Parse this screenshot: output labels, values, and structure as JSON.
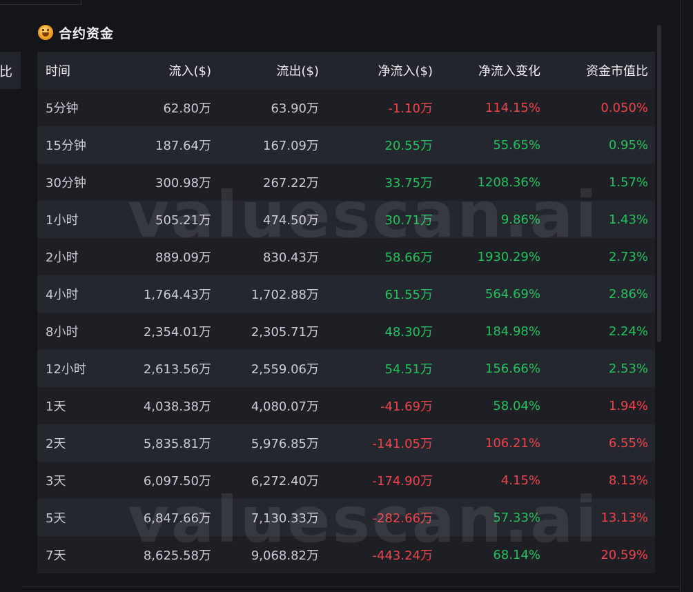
{
  "left_panel": {
    "header_fragment": "比"
  },
  "section": {
    "title": "合约资金",
    "icon": "coin-icon"
  },
  "table": {
    "headers": [
      "时间",
      "流入($)",
      "流出($)",
      "净流入($)",
      "净流入变化",
      "资金市值比"
    ],
    "rows": [
      {
        "time": "5分钟",
        "inflow": "62.80万",
        "outflow": "63.90万",
        "net": "-1.10万",
        "change": "114.15%",
        "ratio": "0.050%",
        "net_sign": "neg",
        "change_sign": "neg",
        "ratio_sign": "neg"
      },
      {
        "time": "15分钟",
        "inflow": "187.64万",
        "outflow": "167.09万",
        "net": "20.55万",
        "change": "55.65%",
        "ratio": "0.95%",
        "net_sign": "pos",
        "change_sign": "pos",
        "ratio_sign": "pos"
      },
      {
        "time": "30分钟",
        "inflow": "300.98万",
        "outflow": "267.22万",
        "net": "33.75万",
        "change": "1208.36%",
        "ratio": "1.57%",
        "net_sign": "pos",
        "change_sign": "pos",
        "ratio_sign": "pos"
      },
      {
        "time": "1小时",
        "inflow": "505.21万",
        "outflow": "474.50万",
        "net": "30.71万",
        "change": "9.86%",
        "ratio": "1.43%",
        "net_sign": "pos",
        "change_sign": "pos",
        "ratio_sign": "pos"
      },
      {
        "time": "2小时",
        "inflow": "889.09万",
        "outflow": "830.43万",
        "net": "58.66万",
        "change": "1930.29%",
        "ratio": "2.73%",
        "net_sign": "pos",
        "change_sign": "pos",
        "ratio_sign": "pos"
      },
      {
        "time": "4小时",
        "inflow": "1,764.43万",
        "outflow": "1,702.88万",
        "net": "61.55万",
        "change": "564.69%",
        "ratio": "2.86%",
        "net_sign": "pos",
        "change_sign": "pos",
        "ratio_sign": "pos"
      },
      {
        "time": "8小时",
        "inflow": "2,354.01万",
        "outflow": "2,305.71万",
        "net": "48.30万",
        "change": "184.98%",
        "ratio": "2.24%",
        "net_sign": "pos",
        "change_sign": "pos",
        "ratio_sign": "pos"
      },
      {
        "time": "12小时",
        "inflow": "2,613.56万",
        "outflow": "2,559.06万",
        "net": "54.51万",
        "change": "156.66%",
        "ratio": "2.53%",
        "net_sign": "pos",
        "change_sign": "pos",
        "ratio_sign": "pos"
      },
      {
        "time": "1天",
        "inflow": "4,038.38万",
        "outflow": "4,080.07万",
        "net": "-41.69万",
        "change": "58.04%",
        "ratio": "1.94%",
        "net_sign": "neg",
        "change_sign": "pos",
        "ratio_sign": "neg"
      },
      {
        "time": "2天",
        "inflow": "5,835.81万",
        "outflow": "5,976.85万",
        "net": "-141.05万",
        "change": "106.21%",
        "ratio": "6.55%",
        "net_sign": "neg",
        "change_sign": "neg",
        "ratio_sign": "neg"
      },
      {
        "time": "3天",
        "inflow": "6,097.50万",
        "outflow": "6,272.40万",
        "net": "-174.90万",
        "change": "4.15%",
        "ratio": "8.13%",
        "net_sign": "neg",
        "change_sign": "neg",
        "ratio_sign": "neg"
      },
      {
        "time": "5天",
        "inflow": "6,847.66万",
        "outflow": "7,130.33万",
        "net": "-282.66万",
        "change": "57.33%",
        "ratio": "13.13%",
        "net_sign": "neg",
        "change_sign": "pos",
        "ratio_sign": "neg"
      },
      {
        "time": "7天",
        "inflow": "8,625.58万",
        "outflow": "9,068.82万",
        "net": "-443.24万",
        "change": "68.14%",
        "ratio": "20.59%",
        "net_sign": "neg",
        "change_sign": "pos",
        "ratio_sign": "neg"
      }
    ]
  },
  "watermark": {
    "text": "valuescan.ai"
  },
  "colors": {
    "positive": "#21c25e",
    "negative": "#f0424b",
    "background": "#141519",
    "header_bg": "#23252d"
  }
}
